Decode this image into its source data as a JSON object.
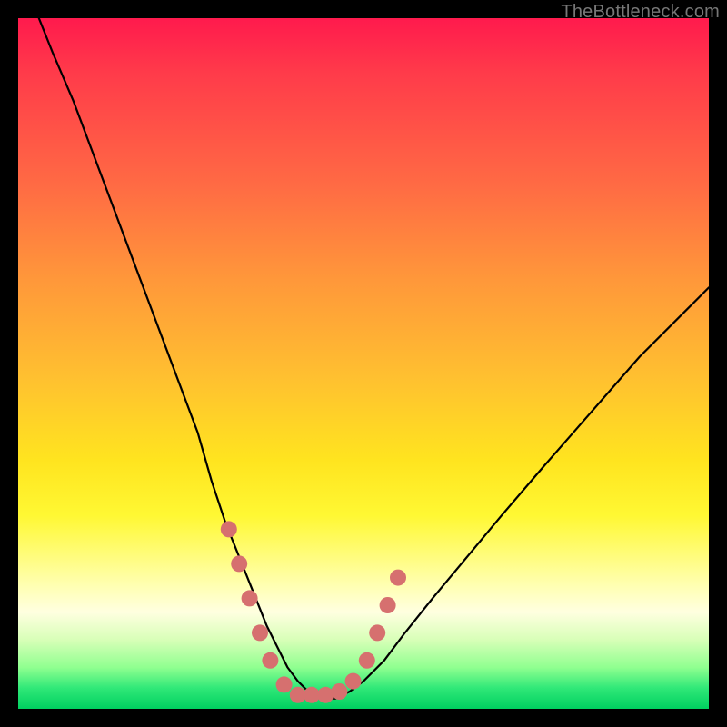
{
  "watermark": "TheBottleneck.com",
  "chart_data": {
    "type": "line",
    "title": "",
    "xlabel": "",
    "ylabel": "",
    "xlim": [
      0,
      100
    ],
    "ylim": [
      0,
      100
    ],
    "series": [
      {
        "name": "bottleneck-curve",
        "color": "#000000",
        "x": [
          3,
          5,
          8,
          11,
          14,
          17,
          20,
          23,
          26,
          28,
          30,
          32,
          34,
          36,
          37.5,
          39,
          40.5,
          42,
          44,
          46,
          48,
          50,
          53,
          56,
          60,
          65,
          70,
          76,
          83,
          90,
          97,
          100
        ],
        "y": [
          100,
          95,
          88,
          80,
          72,
          64,
          56,
          48,
          40,
          33,
          27,
          22,
          17,
          12,
          9,
          6,
          4,
          2.5,
          1.5,
          1.5,
          2.5,
          4,
          7,
          11,
          16,
          22,
          28,
          35,
          43,
          51,
          58,
          61
        ]
      }
    ],
    "markers": {
      "name": "highlight-dots",
      "color": "#d6706f",
      "radius": 9,
      "points": [
        {
          "x": 30.5,
          "y": 26
        },
        {
          "x": 32.0,
          "y": 21
        },
        {
          "x": 33.5,
          "y": 16
        },
        {
          "x": 35.0,
          "y": 11
        },
        {
          "x": 36.5,
          "y": 7
        },
        {
          "x": 38.5,
          "y": 3.5
        },
        {
          "x": 40.5,
          "y": 2
        },
        {
          "x": 42.5,
          "y": 2
        },
        {
          "x": 44.5,
          "y": 2
        },
        {
          "x": 46.5,
          "y": 2.5
        },
        {
          "x": 48.5,
          "y": 4
        },
        {
          "x": 50.5,
          "y": 7
        },
        {
          "x": 52.0,
          "y": 11
        },
        {
          "x": 53.5,
          "y": 15
        },
        {
          "x": 55.0,
          "y": 19
        }
      ]
    }
  }
}
